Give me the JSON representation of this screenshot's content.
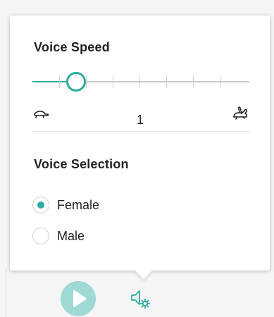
{
  "voice_speed": {
    "title": "Voice Speed",
    "value": 1,
    "value_label": "1",
    "slow_icon": "turtle-icon",
    "fast_icon": "rabbit-icon"
  },
  "voice_selection": {
    "title": "Voice Selection",
    "options": [
      {
        "label": "Female",
        "selected": true
      },
      {
        "label": "Male",
        "selected": false
      }
    ]
  },
  "toolbar": {
    "play_icon": "play-icon",
    "settings_icon": "speaker-settings-icon"
  },
  "colors": {
    "accent": "#2bada0",
    "accent_light": "#9edad3"
  }
}
